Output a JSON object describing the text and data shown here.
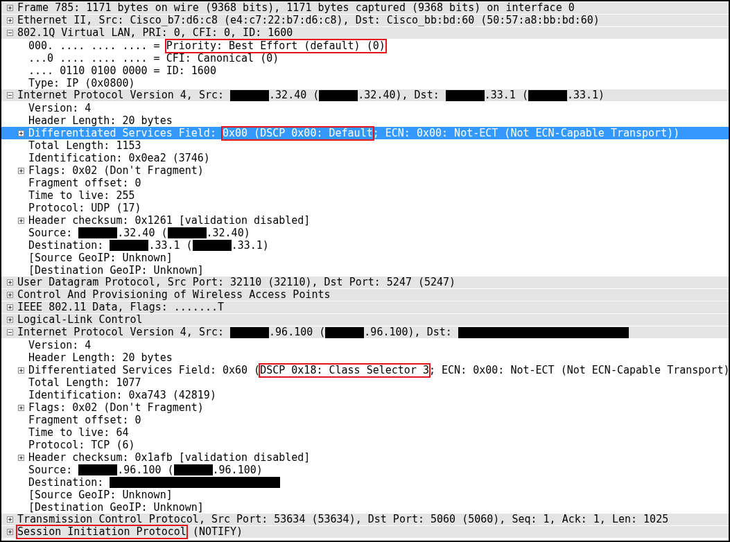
{
  "tree": [
    {
      "text": "Frame 785: 1171 bytes on wire (9368 bits), 1171 bytes captured (9368 bits) on interface 0",
      "expanded": false,
      "selected": false
    },
    {
      "text": "Ethernet II, Src: Cisco_b7:d6:c8 (e4:c7:22:b7:d6:c8), Dst: Cisco_bb:bd:60 (50:57:a8:bb:bd:60)",
      "expanded": false,
      "selected": false
    },
    {
      "text": "802.1Q Virtual LAN, PRI: 0, CFI: 0, ID: 1600",
      "expanded": true,
      "selected": false,
      "children": [
        {
          "segments": [
            {
              "kind": "text",
              "text": "000. .... .... .... = "
            },
            {
              "kind": "highlight",
              "text": "Priority: Best Effort (default) (0)"
            }
          ],
          "selected": false
        },
        {
          "text": "...0 .... .... .... = CFI: Canonical (0)",
          "selected": false
        },
        {
          "text": ".... 0110 0100 0000 = ID: 1600",
          "selected": false
        },
        {
          "text": "Type: IP (0x0800)",
          "selected": false
        }
      ]
    },
    {
      "segments": [
        {
          "kind": "text",
          "text": "Internet Protocol Version 4, Src: "
        },
        {
          "kind": "redacted",
          "wide": false
        },
        {
          "kind": "text",
          "text": ".32.40 ("
        },
        {
          "kind": "redacted",
          "wide": false
        },
        {
          "kind": "text",
          "text": ".32.40), Dst: "
        },
        {
          "kind": "redacted",
          "wide": false
        },
        {
          "kind": "text",
          "text": ".33.1 ("
        },
        {
          "kind": "redacted",
          "wide": false
        },
        {
          "kind": "text",
          "text": ".33.1)"
        }
      ],
      "expanded": true,
      "selected": false,
      "children": [
        {
          "text": "Version: 4",
          "selected": false
        },
        {
          "text": "Header Length: 20 bytes",
          "selected": false
        },
        {
          "segments": [
            {
              "kind": "text",
              "text": "Differentiated Services Field: "
            },
            {
              "kind": "highlight",
              "text": "0x00 (DSCP 0x00: Default"
            },
            {
              "kind": "text",
              "text": "; ECN: 0x00: Not-ECT (Not ECN-Capable Transport))"
            }
          ],
          "expanded": false,
          "selected": true
        },
        {
          "text": "Total Length: 1153",
          "selected": false
        },
        {
          "text": "Identification: 0x0ea2 (3746)",
          "selected": false
        },
        {
          "text": "Flags: 0x02 (Don't Fragment)",
          "expanded": false,
          "selected": false
        },
        {
          "text": "Fragment offset: 0",
          "selected": false
        },
        {
          "text": "Time to live: 255",
          "selected": false
        },
        {
          "text": "Protocol: UDP (17)",
          "selected": false
        },
        {
          "text": "Header checksum: 0x1261 [validation disabled]",
          "expanded": false,
          "selected": false
        },
        {
          "segments": [
            {
              "kind": "text",
              "text": "Source: "
            },
            {
              "kind": "redacted",
              "wide": false
            },
            {
              "kind": "text",
              "text": ".32.40 ("
            },
            {
              "kind": "redacted",
              "wide": false
            },
            {
              "kind": "text",
              "text": ".32.40)"
            }
          ],
          "selected": false
        },
        {
          "segments": [
            {
              "kind": "text",
              "text": "Destination: "
            },
            {
              "kind": "redacted",
              "wide": false
            },
            {
              "kind": "text",
              "text": ".33.1 ("
            },
            {
              "kind": "redacted",
              "wide": false
            },
            {
              "kind": "text",
              "text": ".33.1)"
            }
          ],
          "selected": false
        },
        {
          "text": "[Source GeoIP: Unknown]",
          "selected": false
        },
        {
          "text": "[Destination GeoIP: Unknown]",
          "selected": false
        }
      ]
    },
    {
      "text": "User Datagram Protocol, Src Port: 32110 (32110), Dst Port: 5247 (5247)",
      "expanded": false,
      "selected": false
    },
    {
      "text": "Control And Provisioning of Wireless Access Points",
      "expanded": false,
      "selected": false
    },
    {
      "text": "IEEE 802.11 Data, Flags: .......T",
      "expanded": false,
      "selected": false
    },
    {
      "text": "Logical-Link Control",
      "expanded": false,
      "selected": false
    },
    {
      "segments": [
        {
          "kind": "text",
          "text": "Internet Protocol Version 4, Src: "
        },
        {
          "kind": "redacted",
          "wide": false
        },
        {
          "kind": "text",
          "text": ".96.100 ("
        },
        {
          "kind": "redacted",
          "wide": false
        },
        {
          "kind": "text",
          "text": ".96.100), Dst: "
        },
        {
          "kind": "redacted",
          "wide": true
        }
      ],
      "expanded": true,
      "selected": false,
      "children": [
        {
          "text": "Version: 4",
          "selected": false
        },
        {
          "text": "Header Length: 20 bytes",
          "selected": false
        },
        {
          "segments": [
            {
              "kind": "text",
              "text": "Differentiated Services Field: 0x60 ("
            },
            {
              "kind": "highlight",
              "text": "DSCP 0x18: Class Selector 3"
            },
            {
              "kind": "text",
              "text": "; ECN: 0x00: Not-ECT (Not ECN-Capable Transport)"
            }
          ],
          "expanded": false,
          "selected": false
        },
        {
          "text": "Total Length: 1077",
          "selected": false
        },
        {
          "text": "Identification: 0xa743 (42819)",
          "selected": false
        },
        {
          "text": "Flags: 0x02 (Don't Fragment)",
          "expanded": false,
          "selected": false
        },
        {
          "text": "Fragment offset: 0",
          "selected": false
        },
        {
          "text": "Time to live: 64",
          "selected": false
        },
        {
          "text": "Protocol: TCP (6)",
          "selected": false
        },
        {
          "text": "Header checksum: 0x1afb [validation disabled]",
          "expanded": false,
          "selected": false
        },
        {
          "segments": [
            {
              "kind": "text",
              "text": "Source: "
            },
            {
              "kind": "redacted",
              "wide": false
            },
            {
              "kind": "text",
              "text": ".96.100 ("
            },
            {
              "kind": "redacted",
              "wide": false
            },
            {
              "kind": "text",
              "text": ".96.100)"
            }
          ],
          "selected": false
        },
        {
          "segments": [
            {
              "kind": "text",
              "text": "Destination: "
            },
            {
              "kind": "redacted",
              "wide": true
            }
          ],
          "selected": false
        },
        {
          "text": "[Source GeoIP: Unknown]",
          "selected": false
        },
        {
          "text": "[Destination GeoIP: Unknown]",
          "selected": false
        }
      ]
    },
    {
      "text": "Transmission Control Protocol, Src Port: 53634 (53634), Dst Port: 5060 (5060), Seq: 1, Ack: 1, Len: 1025",
      "expanded": false,
      "selected": false
    },
    {
      "segments": [
        {
          "kind": "highlight",
          "text": "Session Initiation Protocol"
        },
        {
          "kind": "text",
          "text": " (NOTIFY)"
        }
      ],
      "expanded": false,
      "selected": false
    }
  ]
}
